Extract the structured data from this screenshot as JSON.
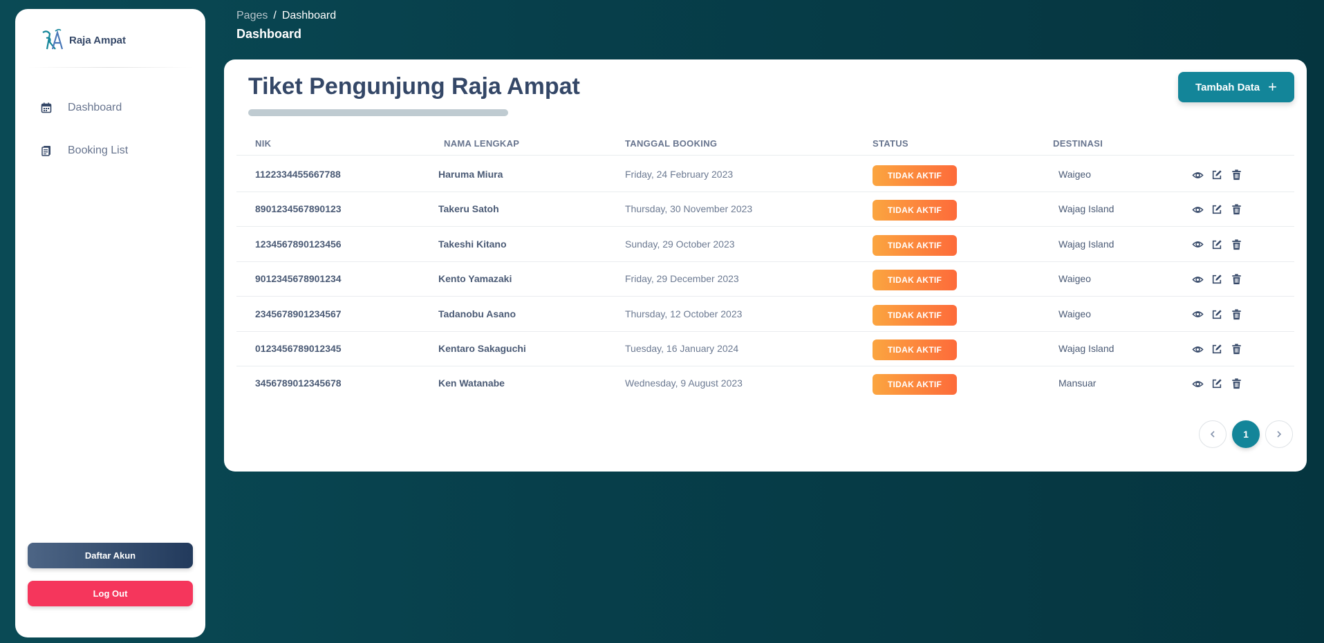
{
  "brand": {
    "name": "Raja Ampat",
    "logo_text": "RA"
  },
  "sidebar": {
    "items": [
      {
        "label": "Dashboard",
        "icon": "calendar-icon"
      },
      {
        "label": "Booking List",
        "icon": "document-icon"
      }
    ],
    "register_label": "Daftar Akun",
    "logout_label": "Log Out"
  },
  "header": {
    "breadcrumb_parent": "Pages",
    "breadcrumb_separator": "/",
    "breadcrumb_current": "Dashboard",
    "title": "Dashboard"
  },
  "main": {
    "title": "Tiket Pengunjung Raja Ampat",
    "add_label": "Tambah Data",
    "add_icon": "plus-icon",
    "columns": [
      "NIK",
      "NAMA LENGKAP",
      "TANGGAL BOOKING",
      "STATUS",
      "DESTINASI"
    ],
    "rows": [
      {
        "nik": "1122334455667788",
        "nama": "Haruma Miura",
        "tanggal": "Friday, 24 February 2023",
        "status": "TIDAK AKTIF",
        "destinasi": "Waigeo"
      },
      {
        "nik": "8901234567890123",
        "nama": "Takeru Satoh",
        "tanggal": "Thursday, 30 November 2023",
        "status": "TIDAK AKTIF",
        "destinasi": "Wajag Island"
      },
      {
        "nik": "1234567890123456",
        "nama": "Takeshi Kitano",
        "tanggal": "Sunday, 29 October 2023",
        "status": "TIDAK AKTIF",
        "destinasi": "Wajag Island"
      },
      {
        "nik": "9012345678901234",
        "nama": "Kento Yamazaki",
        "tanggal": "Friday, 29 December 2023",
        "status": "TIDAK AKTIF",
        "destinasi": "Waigeo"
      },
      {
        "nik": "2345678901234567",
        "nama": "Tadanobu Asano",
        "tanggal": "Thursday, 12 October 2023",
        "status": "TIDAK AKTIF",
        "destinasi": "Waigeo"
      },
      {
        "nik": "0123456789012345",
        "nama": "Kentaro Sakaguchi",
        "tanggal": "Tuesday, 16 January 2024",
        "status": "TIDAK AKTIF",
        "destinasi": "Wajag Island"
      },
      {
        "nik": "3456789012345678",
        "nama": "Ken Watanabe",
        "tanggal": "Wednesday, 9 August 2023",
        "status": "TIDAK AKTIF",
        "destinasi": "Mansuar"
      }
    ],
    "row_action_icons": [
      "eye-icon",
      "edit-icon",
      "trash-icon"
    ]
  },
  "pagination": {
    "current_page": "1",
    "prev_icon": "chevron-left-icon",
    "next_icon": "chevron-right-icon"
  },
  "colors": {
    "background": "#073f4b",
    "accent": "#138599",
    "status_badge_start": "#fba540",
    "status_badge_end": "#fd6b3a",
    "logout": "#f5365c",
    "register_start": "#4d6585",
    "register_end": "#223a5c"
  }
}
